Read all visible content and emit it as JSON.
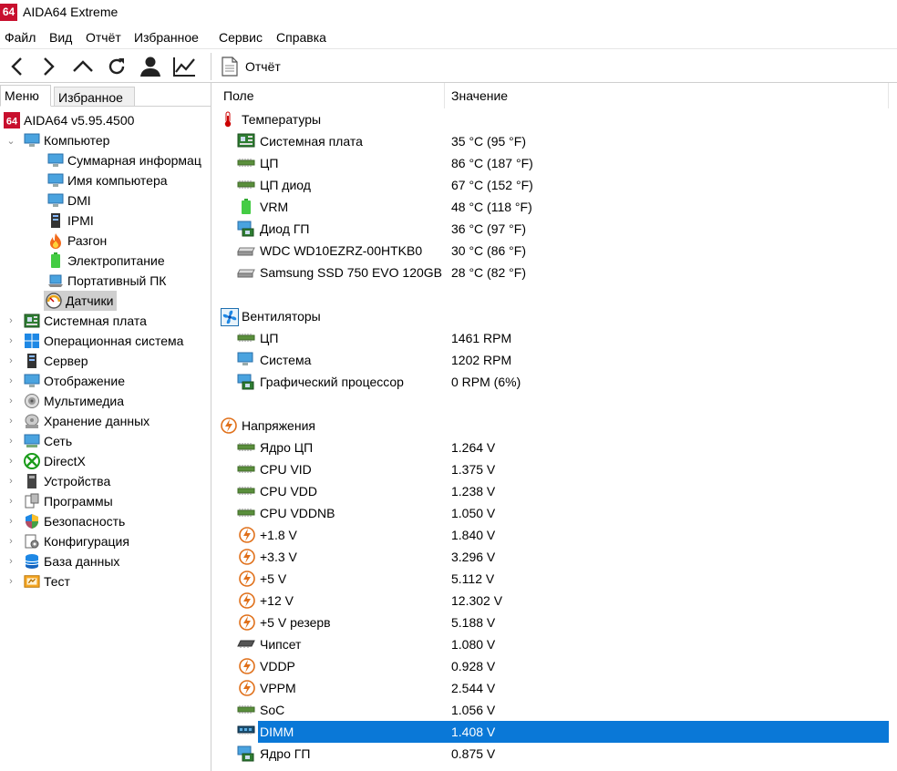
{
  "window": {
    "title": "AIDA64 Extreme",
    "logo_text": "64"
  },
  "menu": [
    "Файл",
    "Вид",
    "Отчёт",
    "Избранное",
    "Сервис",
    "Справка"
  ],
  "toolbar": {
    "report_label": "Отчёт"
  },
  "sidebar": {
    "tabs": [
      "Меню",
      "Избранное"
    ],
    "root": {
      "label": "AIDA64 v5.95.4500",
      "icon": "aida64-logo-icon"
    },
    "computer": {
      "label": "Компьютер",
      "children": [
        {
          "label": "Суммарная информац",
          "icon": "computer-icon"
        },
        {
          "label": "Имя компьютера",
          "icon": "computer-icon"
        },
        {
          "label": "DMI",
          "icon": "computer-icon"
        },
        {
          "label": "IPMI",
          "icon": "server-tower-icon"
        },
        {
          "label": "Разгон",
          "icon": "flame-icon"
        },
        {
          "label": "Электропитание",
          "icon": "battery-icon"
        },
        {
          "label": "Портативный ПК",
          "icon": "laptop-icon"
        },
        {
          "label": "Датчики",
          "icon": "gauge-icon"
        }
      ]
    },
    "categories": [
      {
        "label": "Системная плата",
        "icon": "motherboard-icon"
      },
      {
        "label": "Операционная система",
        "icon": "windows-icon"
      },
      {
        "label": "Сервер",
        "icon": "server-icon"
      },
      {
        "label": "Отображение",
        "icon": "monitor-icon"
      },
      {
        "label": "Мультимедиа",
        "icon": "speaker-icon"
      },
      {
        "label": "Хранение данных",
        "icon": "disk-icon"
      },
      {
        "label": "Сеть",
        "icon": "network-icon"
      },
      {
        "label": "DirectX",
        "icon": "xbox-icon"
      },
      {
        "label": "Устройства",
        "icon": "devices-icon"
      },
      {
        "label": "Программы",
        "icon": "programs-icon"
      },
      {
        "label": "Безопасность",
        "icon": "shield-icon"
      },
      {
        "label": "Конфигурация",
        "icon": "config-icon"
      },
      {
        "label": "База данных",
        "icon": "database-icon"
      },
      {
        "label": "Тест",
        "icon": "benchmark-icon"
      }
    ]
  },
  "table": {
    "headers": {
      "field": "Поле",
      "value": "Значение"
    },
    "sections": [
      {
        "title": "Температуры",
        "icon": "thermometer-icon",
        "rows": [
          {
            "field": "Системная плата",
            "value": "35 °C  (95 °F)",
            "icon": "motherboard-icon"
          },
          {
            "field": "ЦП",
            "value": "86 °C  (187 °F)",
            "icon": "chip-icon"
          },
          {
            "field": "ЦП диод",
            "value": "67 °C  (152 °F)",
            "icon": "chip-icon"
          },
          {
            "field": "VRM",
            "value": "48 °C  (118 °F)",
            "icon": "battery-icon"
          },
          {
            "field": "Диод ГП",
            "value": "36 °C  (97 °F)",
            "icon": "gpu-icon"
          },
          {
            "field": "WDC WD10EZRZ-00HTKB0",
            "value": "30 °C  (86 °F)",
            "icon": "disk-icon"
          },
          {
            "field": "Samsung SSD 750 EVO 120GB",
            "value": "28 °C  (82 °F)",
            "icon": "disk-icon"
          }
        ]
      },
      {
        "title": "Вентиляторы",
        "icon": "fan-icon",
        "rows": [
          {
            "field": "ЦП",
            "value": "1461 RPM",
            "icon": "chip-icon"
          },
          {
            "field": "Система",
            "value": "1202 RPM",
            "icon": "computer-icon"
          },
          {
            "field": "Графический процессор",
            "value": "0 RPM  (6%)",
            "icon": "gpu-icon"
          }
        ]
      },
      {
        "title": "Напряжения",
        "icon": "voltage-icon",
        "rows": [
          {
            "field": "Ядро ЦП",
            "value": "1.264 V",
            "icon": "chip-icon"
          },
          {
            "field": "CPU VID",
            "value": "1.375 V",
            "icon": "chip-icon"
          },
          {
            "field": "CPU VDD",
            "value": "1.238 V",
            "icon": "chip-icon"
          },
          {
            "field": "CPU VDDNB",
            "value": "1.050 V",
            "icon": "chip-icon"
          },
          {
            "field": "+1.8 V",
            "value": "1.840 V",
            "icon": "voltage-icon"
          },
          {
            "field": "+3.3 V",
            "value": "3.296 V",
            "icon": "voltage-icon"
          },
          {
            "field": "+5 V",
            "value": "5.112 V",
            "icon": "voltage-icon"
          },
          {
            "field": "+12 V",
            "value": "12.302 V",
            "icon": "voltage-icon"
          },
          {
            "field": "+5 V резерв",
            "value": "5.188 V",
            "icon": "voltage-icon"
          },
          {
            "field": "Чипсет",
            "value": "1.080 V",
            "icon": "chipset-icon"
          },
          {
            "field": "VDDP",
            "value": "0.928 V",
            "icon": "voltage-icon"
          },
          {
            "field": "VPPM",
            "value": "2.544 V",
            "icon": "voltage-icon"
          },
          {
            "field": "SoC",
            "value": "1.056 V",
            "icon": "chip-icon"
          },
          {
            "field": "DIMM",
            "value": "1.408 V",
            "icon": "ram-icon",
            "selected": true
          },
          {
            "field": "Ядро ГП",
            "value": "0.875 V",
            "icon": "gpu-icon"
          }
        ]
      }
    ]
  },
  "colors": {
    "selection": "#0a78d7",
    "logo_red": "#c8102e",
    "tree_selected": "#cfcfcf"
  }
}
